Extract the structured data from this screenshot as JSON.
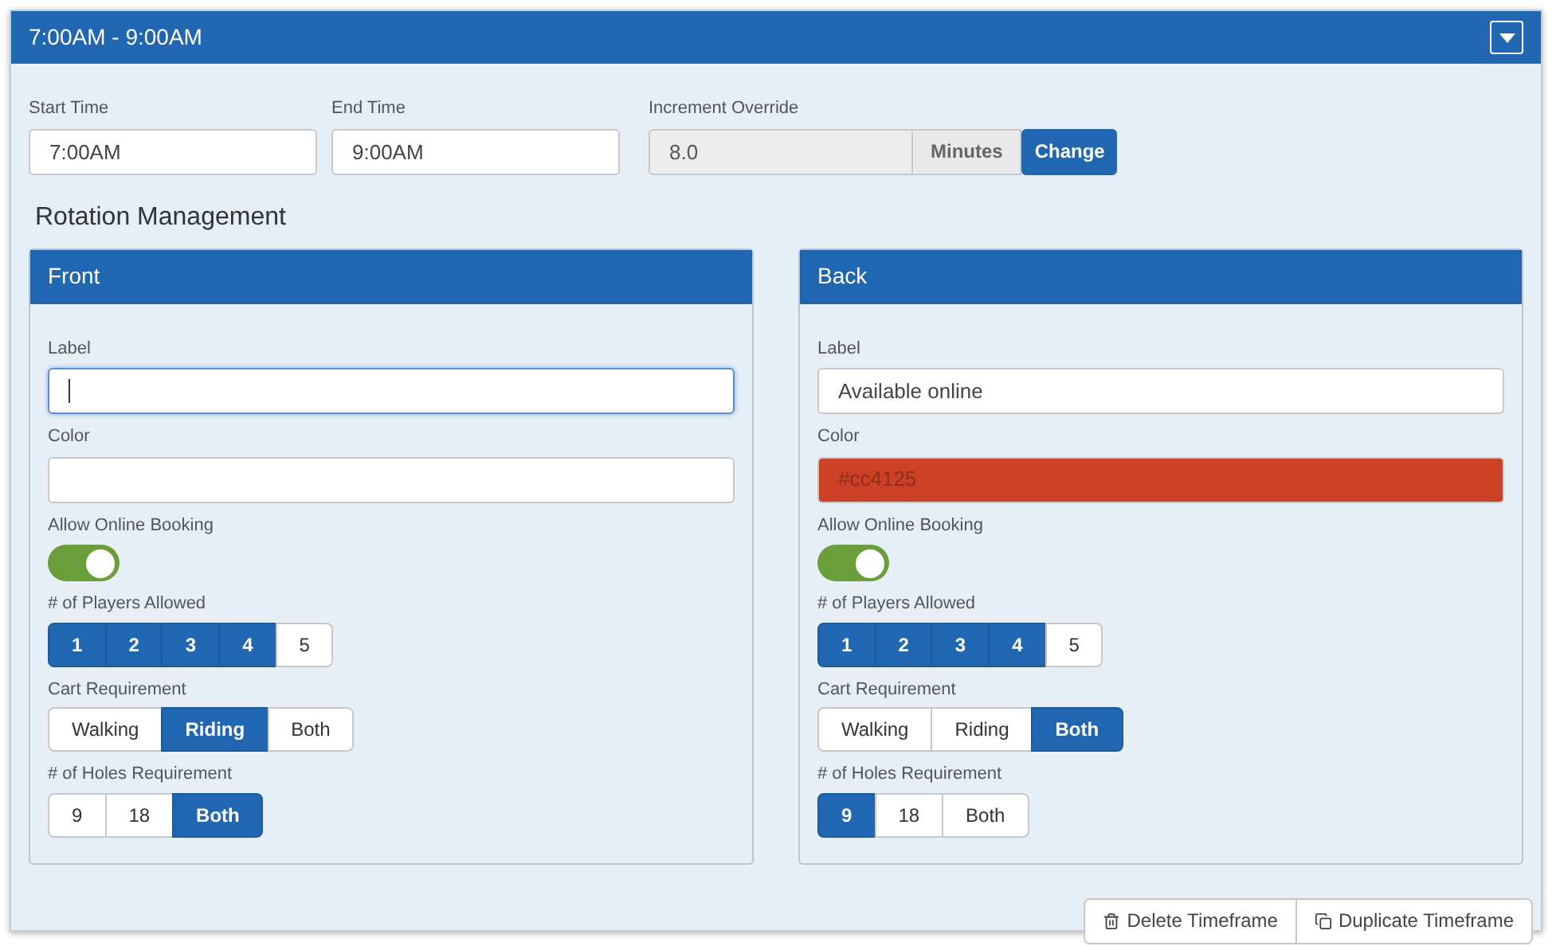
{
  "header": {
    "title": "7:00AM - 9:00AM",
    "expanded": true
  },
  "fields": [
    {
      "label": "Start Time",
      "value": "7:00AM"
    },
    {
      "label": "End Time",
      "value": "9:00AM"
    }
  ],
  "increment": {
    "label": "Increment Override",
    "value": "8.0",
    "disabled": true,
    "unit": "Minutes",
    "button": "Change"
  },
  "section_title": "Rotation Management",
  "panels": [
    {
      "title": "Front",
      "label_field": {
        "label": "Label",
        "focused": true
      },
      "color_field": {
        "label": "Color"
      },
      "online": {
        "label": "Allow Online Booking",
        "on": true
      },
      "groups": [
        {
          "label": "# of Players Allowed",
          "options": [
            {
              "text": "1",
              "selected": true
            },
            {
              "text": "2",
              "selected": true
            },
            {
              "text": "3",
              "selected": true
            },
            {
              "text": "4",
              "selected": true
            },
            {
              "text": "5",
              "selected": false
            }
          ]
        },
        {
          "label": "Cart Requirement",
          "options": [
            {
              "text": "Walking",
              "selected": false
            },
            {
              "text": "Riding",
              "selected": true
            },
            {
              "text": "Both",
              "selected": false
            }
          ]
        },
        {
          "label": "# of Holes Requirement",
          "options": [
            {
              "text": "9",
              "selected": false
            },
            {
              "text": "18",
              "selected": false
            },
            {
              "text": "Both",
              "selected": true
            }
          ]
        }
      ]
    },
    {
      "title": "Back",
      "label_field": {
        "label": "Label",
        "value": "Available online",
        "focused": false
      },
      "color_field": {
        "label": "Color",
        "value": "#cc4125"
      },
      "online": {
        "label": "Allow Online Booking",
        "on": true
      },
      "groups": [
        {
          "label": "# of Players Allowed",
          "options": [
            {
              "text": "1",
              "selected": true
            },
            {
              "text": "2",
              "selected": true
            },
            {
              "text": "3",
              "selected": true
            },
            {
              "text": "4",
              "selected": true
            },
            {
              "text": "5",
              "selected": false
            }
          ]
        },
        {
          "label": "Cart Requirement",
          "options": [
            {
              "text": "Walking",
              "selected": false
            },
            {
              "text": "Riding",
              "selected": false
            },
            {
              "text": "Both",
              "selected": true
            }
          ]
        },
        {
          "label": "# of Holes Requirement",
          "options": [
            {
              "text": "9",
              "selected": true
            },
            {
              "text": "18",
              "selected": false
            },
            {
              "text": "Both",
              "selected": false
            }
          ]
        }
      ]
    }
  ],
  "actions": [
    {
      "kind": "delete",
      "text": "Delete Timeframe"
    },
    {
      "kind": "duplicate",
      "text": "Duplicate Timeframe"
    }
  ]
}
